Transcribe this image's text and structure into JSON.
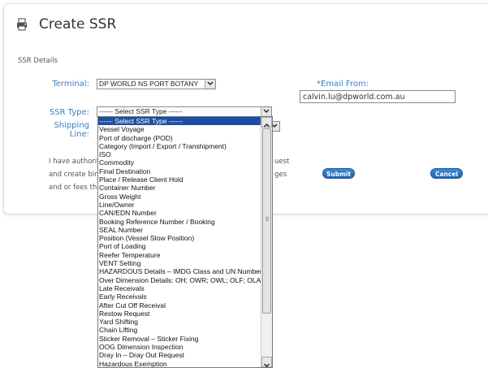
{
  "page": {
    "title": "Create SSR",
    "icon": "printer-icon"
  },
  "section": {
    "label": "SSR Details"
  },
  "form": {
    "terminal": {
      "label": "Terminal:",
      "value": "DP WORLD NS PORT BOTANY"
    },
    "email": {
      "label": "*Email From:",
      "value": "calvin.lu@dpworld.com.au"
    },
    "ssr_type": {
      "label": "SSR Type:",
      "value": "------ Select SSR Type ------"
    },
    "shipping_line": {
      "label": "Shipping Line:"
    }
  },
  "notice": {
    "line1_left": "I have authority",
    "line1_right": "uest",
    "line2_left": "and create bind",
    "line2_right": "ges",
    "line3_left": "and or fees tha"
  },
  "buttons": {
    "submit": "Submit",
    "cancel": "Cancel"
  },
  "ssr_options": [
    "------ Select SSR Type ------",
    "Vessel Voyage",
    "Port of discharge (POD)",
    "Category (Import / Export / Transhipment)",
    "ISO",
    "Commodity",
    "Final Destination",
    "Place / Release Client Hold",
    "Container Number",
    "Gross Weight",
    "Line/Owner",
    "CAN/EDN Number",
    "Booking Reference Number / Booking",
    "SEAL Number",
    "Position (Vessel Stow Position)",
    "Port of Loading",
    "Reefer Temperature",
    "VENT Setting",
    "HAZARDOUS Details – IMDG Class and UN Number",
    "Over Dimension Details: OH; OWR; OWL; OLF; OLA",
    "Late Receivals",
    "Early Receivals",
    "After Cut Off Receival",
    "Restow Request",
    "Yard Shifting",
    "Chain Lifting",
    "Sticker Removal – Sticker Fixing",
    "OOG Dimension Inspection",
    "Dray In – Dray Out Request",
    "Hazardous Exemption"
  ]
}
